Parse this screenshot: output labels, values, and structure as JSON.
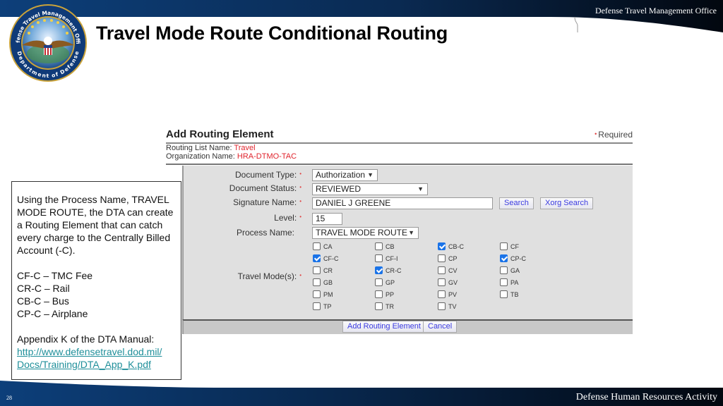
{
  "header": {
    "org": "Defense Travel Management Office",
    "title": "Travel Mode Route Conditional Routing"
  },
  "logo": {
    "top_text": "Defense Travel Management Office",
    "bottom_text": "Department of Defense"
  },
  "form": {
    "title": "Add Routing Element",
    "required_label": "Required",
    "routing_list_label": "Routing List Name:",
    "routing_list_value": "Travel",
    "org_label": "Organization Name:",
    "org_value": "HRA-DTMO-TAC",
    "fields": {
      "document_type": {
        "label": "Document Type:",
        "value": "Authorization"
      },
      "document_status": {
        "label": "Document Status:",
        "value": "REVIEWED"
      },
      "signature_name": {
        "label": "Signature Name:",
        "value": "DANIEL J GREENE"
      },
      "level": {
        "label": "Level:",
        "value": "15"
      },
      "process_name": {
        "label": "Process Name:",
        "value": "TRAVEL MODE ROUTE"
      }
    },
    "search_label": "Search",
    "xorg_search_label": "Xorg Search",
    "travel_modes_label": "Travel Mode(s):",
    "travel_modes": [
      {
        "code": "CA",
        "checked": false
      },
      {
        "code": "CB",
        "checked": false
      },
      {
        "code": "CB-C",
        "checked": true
      },
      {
        "code": "CF",
        "checked": false
      },
      {
        "code": "CF-C",
        "checked": true
      },
      {
        "code": "CF-I",
        "checked": false
      },
      {
        "code": "CP",
        "checked": false
      },
      {
        "code": "CP-C",
        "checked": true
      },
      {
        "code": "CR",
        "checked": false
      },
      {
        "code": "CR-C",
        "checked": true
      },
      {
        "code": "CV",
        "checked": false
      },
      {
        "code": "GA",
        "checked": false
      },
      {
        "code": "GB",
        "checked": false
      },
      {
        "code": "GP",
        "checked": false
      },
      {
        "code": "GV",
        "checked": false
      },
      {
        "code": "PA",
        "checked": false
      },
      {
        "code": "PM",
        "checked": false
      },
      {
        "code": "PP",
        "checked": false
      },
      {
        "code": "PV",
        "checked": false
      },
      {
        "code": "TB",
        "checked": false
      },
      {
        "code": "TP",
        "checked": false
      },
      {
        "code": "TR",
        "checked": false
      },
      {
        "code": "TV",
        "checked": false
      }
    ],
    "add_button": "Add Routing Element",
    "cancel_button": "Cancel"
  },
  "callout": {
    "intro": "Using the Process Name, TRAVEL MODE ROUTE, the DTA can create a Routing Element that can catch every charge to the Centrally Billed Account (-C).",
    "codes": [
      "CF-C – TMC Fee",
      "CR-C – Rail",
      "CB-C – Bus",
      "CP-C – Airplane"
    ],
    "appendix": "Appendix K of the DTA Manual:",
    "link_line1": "http://www.defensetravel.dod.mil/",
    "link_line2": "Docs/Training/DTA_App_K.pdf"
  },
  "footer": {
    "page_number": "28",
    "org": "Defense Human Resources Activity"
  },
  "colors": {
    "banner_dark": "#04101f",
    "banner_blue": "#0d3f7a",
    "required_red": "#e0242d",
    "link_teal": "#1f8f9a",
    "checkbox_blue": "#1a73e8"
  }
}
